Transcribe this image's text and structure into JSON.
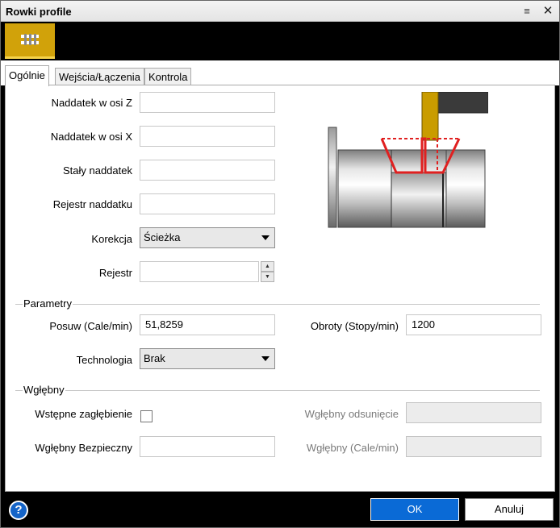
{
  "window": {
    "title": "Rowki profile",
    "menu_glyph": "≡",
    "close_glyph": "✕"
  },
  "toolbar": {
    "tool_icon": "groove-tool-icon"
  },
  "tabs": [
    {
      "label": "Ogólnie",
      "active": true
    },
    {
      "label": "Wejścia/Łączenia",
      "active": false
    },
    {
      "label": "Kontrola",
      "active": false
    }
  ],
  "general": {
    "z_stock_label": "Naddatek w osi Z",
    "z_stock_value": "",
    "x_stock_label": "Naddatek w osi X",
    "x_stock_value": "",
    "constant_stock_label": "Stały naddatek",
    "constant_stock_value": "",
    "stock_register_label": "Rejestr naddatku",
    "stock_register_value": "",
    "correction_label": "Korekcja",
    "correction_value": "Ścieżka",
    "register_label": "Rejestr",
    "register_value": ""
  },
  "parameters": {
    "group_label": "Parametry",
    "feed_label": "Posuw (Cale/min)",
    "feed_value": "51,8259",
    "speed_label": "Obroty (Stopy/min)",
    "speed_value": "1200",
    "technology_label": "Technologia",
    "technology_value": "Brak"
  },
  "plunge": {
    "group_label": "Wgłębny",
    "pre_plunge_label": "Wstępne zagłębienie",
    "pre_plunge_checked": false,
    "plunge_retract_label": "Wgłębny odsunięcie",
    "plunge_retract_value": "",
    "safe_plunge_label": "Wgłębny Bezpieczny",
    "safe_plunge_value": "",
    "plunge_feed_label": "Wgłębny  (Cale/min)",
    "plunge_feed_value": ""
  },
  "footer": {
    "help_glyph": "?",
    "ok_label": "OK",
    "cancel_label": "Anuluj"
  },
  "colors": {
    "accent": "#0a6ad6",
    "tool_yellow": "#d1a20a",
    "groove_red": "#e02020"
  }
}
